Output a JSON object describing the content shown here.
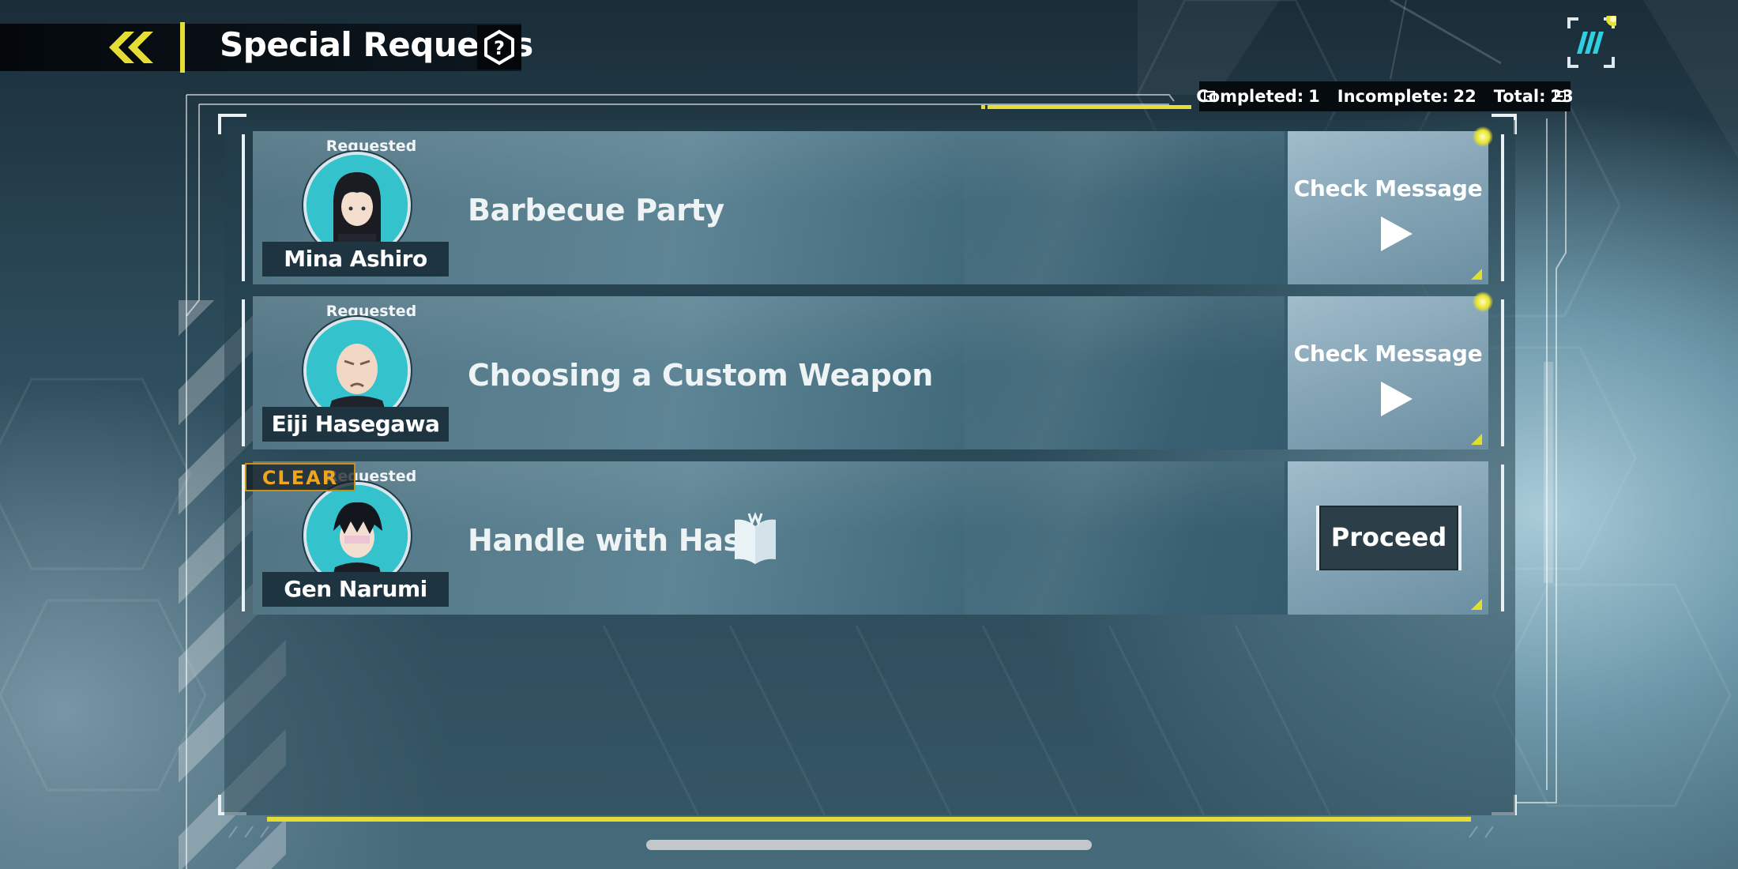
{
  "header": {
    "title": "Special Requests",
    "back_icon": "double-chevron-left-icon",
    "help_icon": "hexagon-question-icon",
    "menu_icon": "striped-badge-icon"
  },
  "stats": {
    "completed_label": "Completed:",
    "completed_value": "1",
    "incomplete_label": "Incomplete:",
    "incomplete_value": "22",
    "total_label": "Total:",
    "total_value": "23"
  },
  "requests": [
    {
      "status": "Requested",
      "character": "Mina Ashiro",
      "title": "Barbecue Party",
      "action": "Check Message",
      "has_notification": true
    },
    {
      "status": "Requested",
      "character": "Eiji Hasegawa",
      "title": "Choosing a Custom Weapon",
      "action": "Check Message",
      "has_notification": true
    },
    {
      "status": "Requested",
      "character": "Gen Narumi",
      "title": "Handle with Haste",
      "action": "Proceed",
      "clear_badge": "CLEAR",
      "title_icon": "open-book-icon"
    }
  ],
  "colors": {
    "accent_yellow": "#e6dc36",
    "clear_orange": "#f0a51d",
    "avatar_bg": "#32c0cb"
  }
}
